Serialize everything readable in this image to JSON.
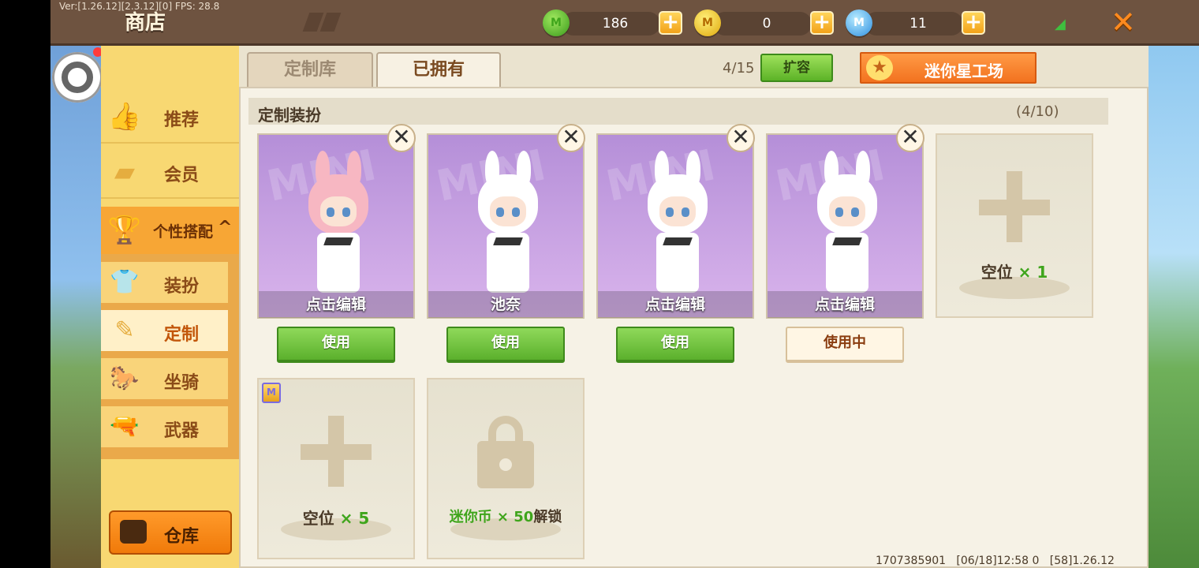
{
  "debug": {
    "version": "Ver:[1.26.12][2.3.12][0] FPS: 28.8"
  },
  "header": {
    "title": "商店",
    "currencies": [
      {
        "name": "mini-bean",
        "icon": "green-gem-icon",
        "value": "186"
      },
      {
        "name": "mini-coin",
        "icon": "gold-coin-icon",
        "value": "0"
      },
      {
        "name": "mini-point",
        "icon": "blue-coin-icon",
        "value": "11"
      }
    ],
    "add_label": "+",
    "close_label": "✕"
  },
  "sidebar": {
    "items": [
      {
        "label": "推荐",
        "icon": "thumbs-up-icon"
      },
      {
        "label": "会员",
        "icon": "member-icon"
      },
      {
        "label": "个性搭配",
        "icon": "trophy-icon",
        "expanded": true
      }
    ],
    "sub_items": [
      {
        "label": "装扮",
        "icon": "shirt-icon"
      },
      {
        "label": "定制",
        "icon": "pencil-icon",
        "active": true
      },
      {
        "label": "坐骑",
        "icon": "mount-icon"
      },
      {
        "label": "武器",
        "icon": "gun-icon"
      }
    ],
    "warehouse_label": "仓库",
    "expand_caret": "^"
  },
  "tabs": [
    {
      "label": "定制库",
      "active": false
    },
    {
      "label": "已拥有",
      "active": true
    }
  ],
  "capacity": {
    "count": "4/15",
    "expand_label": "扩容"
  },
  "workshop": {
    "label": "迷你星工场",
    "star": "★"
  },
  "section": {
    "title": "定制装扮",
    "count": "(4/10)"
  },
  "cards": [
    {
      "name": "点击编辑",
      "button": "使用",
      "in_use": false,
      "hair": "#f7b7c2"
    },
    {
      "name": "池奈",
      "button": "使用",
      "in_use": false,
      "hair": "#ffffff"
    },
    {
      "name": "点击编辑",
      "button": "使用",
      "in_use": false,
      "hair": "#ffffff"
    },
    {
      "name": "点击编辑",
      "button": "使用中",
      "in_use": true,
      "hair": "#ffffff"
    }
  ],
  "delete_label": "✕",
  "slots": {
    "empty1": {
      "label": "空位",
      "count": "× 1"
    },
    "empty5": {
      "label": "空位",
      "count": "× 5",
      "badge": "M"
    },
    "locked": {
      "prefix": "迷你币 × 50",
      "suffix": "解锁"
    }
  },
  "footer": {
    "text": "1707385901   [06/18]12:58 0   [58]1.26.12"
  },
  "colors": {
    "accent_orange": "#f7a635",
    "green_button": "#5bb02c",
    "panel": "#f6f2e6",
    "sidebar": "#f8d872"
  }
}
